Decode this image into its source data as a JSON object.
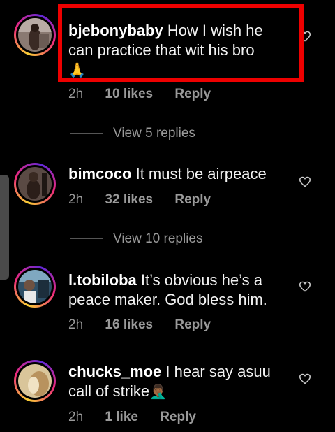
{
  "comments": [
    {
      "username": "bjebonybaby",
      "text": "How I wish he can practice that wit his bro",
      "emoji": "🙏",
      "time": "2h",
      "likes": "10 likes",
      "reply": "Reply",
      "view_replies": "View 5 replies"
    },
    {
      "username": "bimcoco",
      "text": "It must be airpeace",
      "emoji": "",
      "time": "2h",
      "likes": "32 likes",
      "reply": "Reply",
      "view_replies": "View 10 replies"
    },
    {
      "username": "l.tobiloba",
      "text": "It’s obvious he’s a peace maker. God bless him.",
      "emoji": "",
      "time": "2h",
      "likes": "16 likes",
      "reply": "Reply"
    },
    {
      "username": "chucks_moe",
      "text": "I hear say asuu call of strike",
      "emoji": "🤦🏾‍♂️",
      "time": "2h",
      "likes": "1 like",
      "reply": "Reply"
    }
  ],
  "colors": {
    "background": "#000000",
    "highlight": "#ee0000",
    "meta": "#9a9a9a"
  },
  "icons": {
    "like": "heart-outline-icon"
  }
}
